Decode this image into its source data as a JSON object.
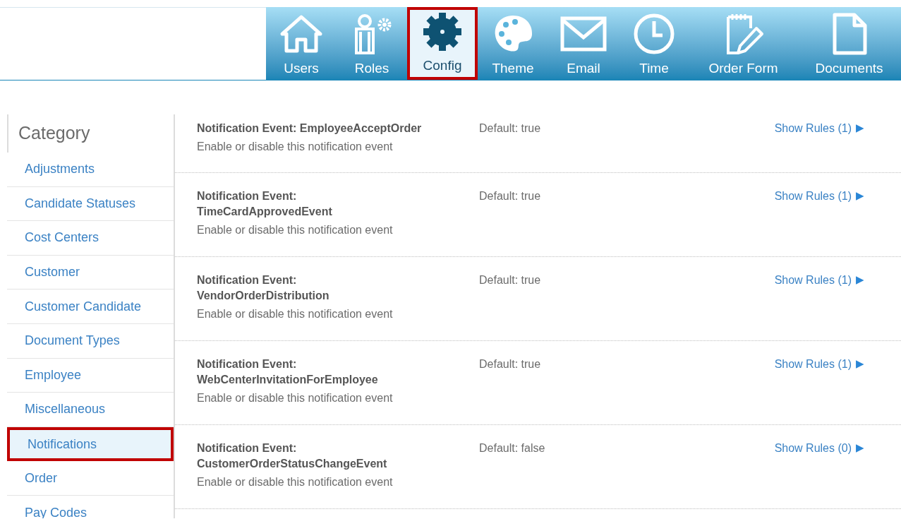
{
  "nav": [
    {
      "label": "Users",
      "kind": "house",
      "selected": false
    },
    {
      "label": "Roles",
      "kind": "roles",
      "selected": false
    },
    {
      "label": "Config",
      "kind": "gear",
      "selected": true
    },
    {
      "label": "Theme",
      "kind": "palette",
      "selected": false
    },
    {
      "label": "Email",
      "kind": "envelope",
      "selected": false
    },
    {
      "label": "Time",
      "kind": "clock",
      "selected": false
    },
    {
      "label": "Order Form",
      "kind": "notepad",
      "selected": false
    },
    {
      "label": "Documents",
      "kind": "document",
      "selected": false
    }
  ],
  "sidebar": {
    "title": "Category",
    "items": [
      {
        "label": "Adjustments",
        "selected": false
      },
      {
        "label": "Candidate Statuses",
        "selected": false
      },
      {
        "label": "Cost Centers",
        "selected": false
      },
      {
        "label": "Customer",
        "selected": false
      },
      {
        "label": "Customer Candidate",
        "selected": false
      },
      {
        "label": "Document Types",
        "selected": false
      },
      {
        "label": "Employee",
        "selected": false
      },
      {
        "label": "Miscellaneous",
        "selected": false
      },
      {
        "label": "Notifications",
        "selected": true
      },
      {
        "label": "Order",
        "selected": false
      },
      {
        "label": "Pay Codes",
        "selected": false
      }
    ]
  },
  "settings": [
    {
      "title_lines": [
        "Notification Event: EmployeeAcceptOrder"
      ],
      "description": "Enable or disable this notification event",
      "default": "Default: true",
      "link": "Show Rules (1)",
      "arrow": "▶"
    },
    {
      "title_lines": [
        "Notification Event:",
        "TimeCardApprovedEvent"
      ],
      "description": "Enable or disable this notification event",
      "default": "Default: true",
      "link": "Show Rules (1)",
      "arrow": "▶"
    },
    {
      "title_lines": [
        "Notification Event:",
        "VendorOrderDistribution"
      ],
      "description": "Enable or disable this notification event",
      "default": "Default: true",
      "link": "Show Rules (1)",
      "arrow": "▶"
    },
    {
      "title_lines": [
        "Notification Event:",
        "WebCenterInvitationForEmployee"
      ],
      "description": "Enable or disable this notification event",
      "default": "Default: true",
      "link": "Show Rules (1)",
      "arrow": "▶"
    },
    {
      "title_lines": [
        "Notification Event:",
        "CustomerOrderStatusChangeEvent"
      ],
      "description": "Enable or disable this notification event",
      "default": "Default: false",
      "link": "Show Rules (0)",
      "arrow": "▶"
    }
  ]
}
